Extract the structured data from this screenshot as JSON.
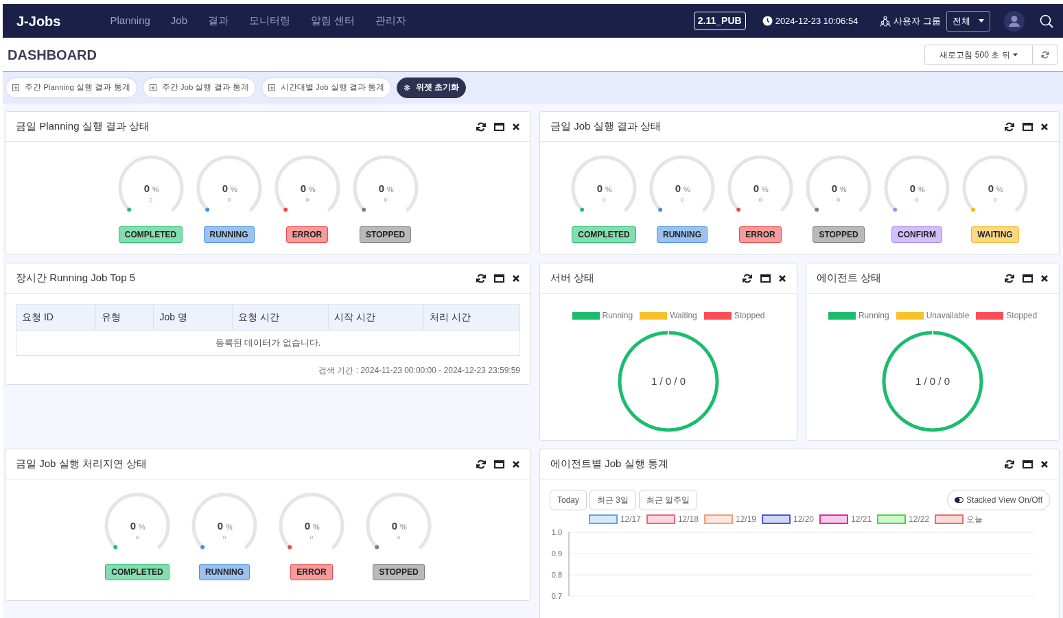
{
  "navbar": {
    "logo": "J-Jobs",
    "menu": [
      "Planning",
      "Job",
      "결과",
      "모니터링",
      "알림 센터",
      "관리자"
    ],
    "version": "2.11_PUB",
    "datetime": "2024-12-23 10:06:54",
    "group_label": "사용자 그룹",
    "group_select": "전체"
  },
  "header": {
    "title": "DASHBOARD",
    "refresh_button": "새로고침 500 초 뒤"
  },
  "widget_buttons": [
    {
      "kind": "add",
      "label": "주간 Planning 실행 결과 통계"
    },
    {
      "kind": "add",
      "label": "주간 Job 실행 결과 통계"
    },
    {
      "kind": "add",
      "label": "시간대별 Job 실행 결과 통계"
    },
    {
      "kind": "reset",
      "label": "위젯 초기화"
    }
  ],
  "widgets": [
    {
      "kind": "gauges",
      "title": "금일 Planning 실행 결과 상태",
      "gauges": [
        {
          "value": "0",
          "unit": "%",
          "count": "0",
          "label": "COMPLETED",
          "color": "#22c06e"
        },
        {
          "value": "0",
          "unit": "%",
          "count": "0",
          "label": "RUNNING",
          "color": "#4a90e2"
        },
        {
          "value": "0",
          "unit": "%",
          "count": "0",
          "label": "ERROR",
          "color": "#f04848"
        },
        {
          "value": "0",
          "unit": "%",
          "count": "0",
          "label": "STOPPED",
          "color": "#808080"
        }
      ]
    },
    {
      "kind": "gauges",
      "title": "금일 Job 실행 결과 상태",
      "gauges": [
        {
          "value": "0",
          "unit": "%",
          "count": "0",
          "label": "COMPLETED",
          "color": "#22c06e"
        },
        {
          "value": "0",
          "unit": "%",
          "count": "0",
          "label": "RUNNING",
          "color": "#4a90e2"
        },
        {
          "value": "0",
          "unit": "%",
          "count": "0",
          "label": "ERROR",
          "color": "#f04848"
        },
        {
          "value": "0",
          "unit": "%",
          "count": "0",
          "label": "STOPPED",
          "color": "#808080"
        },
        {
          "value": "0",
          "unit": "%",
          "count": "0",
          "label": "CONFIRM",
          "color": "#a98af5"
        },
        {
          "value": "0",
          "unit": "%",
          "count": "0",
          "label": "WAITING",
          "color": "#f5b820"
        }
      ]
    },
    {
      "kind": "table",
      "title": "장시간 Running Job Top 5",
      "columns": [
        "요청 ID",
        "유형",
        "Job 명",
        "요청 시간",
        "시작 시간",
        "처리 시간"
      ],
      "empty_message": "등록된 데이터가 없습니다.",
      "period": "검색 기간 : 2024-11-23 00:00:00 - 2024-12-23 23:59:59"
    },
    {
      "kind": "ring",
      "title": "서버 상태",
      "legend": [
        {
          "label": "Running",
          "color": "#1bbd6c"
        },
        {
          "label": "Waiting",
          "color": "#f9c12a"
        },
        {
          "label": "Stopped",
          "color": "#fa4d56"
        }
      ],
      "center": "1 / 0 / 0"
    },
    {
      "kind": "ring",
      "title": "에이전트 상태",
      "legend": [
        {
          "label": "Running",
          "color": "#1bbd6c"
        },
        {
          "label": "Unavailable",
          "color": "#f9c12a"
        },
        {
          "label": "Stopped",
          "color": "#fa4d56"
        }
      ],
      "center": "1 / 0 / 0"
    },
    {
      "kind": "gauges",
      "title": "금일 Job 실행 처리지연 상태",
      "gauges": [
        {
          "value": "0",
          "unit": "%",
          "count": "0",
          "label": "COMPLETED",
          "color": "#22c06e"
        },
        {
          "value": "0",
          "unit": "%",
          "count": "0",
          "label": "RUNNING",
          "color": "#4a90e2"
        },
        {
          "value": "0",
          "unit": "%",
          "count": "0",
          "label": "ERROR",
          "color": "#f04848"
        },
        {
          "value": "0",
          "unit": "%",
          "count": "0",
          "label": "STOPPED",
          "color": "#808080"
        }
      ]
    },
    {
      "kind": "chart",
      "title": "에이전트별 Job 실행 통계",
      "range_buttons": [
        "Today",
        "최근 3일",
        "최근 일주일"
      ],
      "toggle": "Stacked View On/Off",
      "chart_data": {
        "type": "bar",
        "series": [
          {
            "name": "12/17",
            "color": "#5ea4ec"
          },
          {
            "name": "12/18",
            "color": "#f5617f"
          },
          {
            "name": "12/19",
            "color": "#f99a75"
          },
          {
            "name": "12/20",
            "color": "#4a57d9"
          },
          {
            "name": "12/21",
            "color": "#de2aa3"
          },
          {
            "name": "12/22",
            "color": "#45dd3b"
          },
          {
            "name": "오늘",
            "color": "#ee6a6a"
          }
        ],
        "ylim": [
          0.7,
          1
        ],
        "yticks": [
          {
            "value": 1,
            "label": "1.0"
          },
          {
            "value": 0.9,
            "label": "0.9"
          },
          {
            "value": 0.8,
            "label": "0.8"
          },
          {
            "value": 0.7,
            "label": "0.7"
          }
        ]
      }
    }
  ]
}
